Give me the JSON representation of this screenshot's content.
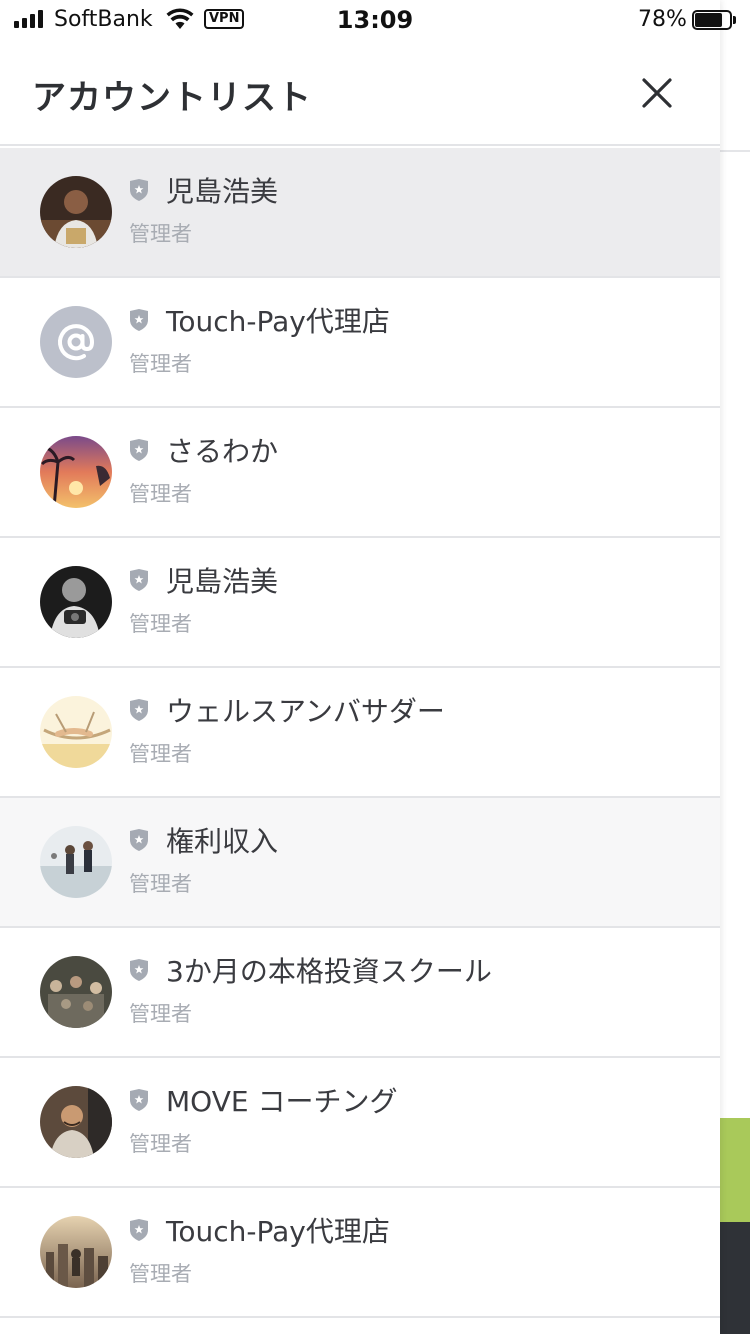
{
  "status_bar": {
    "carrier": "SoftBank",
    "vpn_label": "VPN",
    "time": "13:09",
    "battery_percent": "78%"
  },
  "panel": {
    "title": "アカウントリスト",
    "close_icon": "close-icon"
  },
  "accounts": [
    {
      "name": "児島浩美",
      "role": "管理者",
      "avatar": "photo-man-laptop",
      "selected": true
    },
    {
      "name": "Touch-Pay代理店",
      "role": "管理者",
      "avatar": "at-sign-default"
    },
    {
      "name": "さるわか",
      "role": "管理者",
      "avatar": "photo-sunset-beach"
    },
    {
      "name": "児島浩美",
      "role": "管理者",
      "avatar": "photo-man-camera-bw"
    },
    {
      "name": "ウェルスアンバサダー",
      "role": "管理者",
      "avatar": "photo-beach-hammock"
    },
    {
      "name": "権利収入",
      "role": "管理者",
      "avatar": "photo-runners-beach"
    },
    {
      "name": "3か月の本格投資スクール",
      "role": "管理者",
      "avatar": "photo-crowd-party"
    },
    {
      "name": "MOVE コーチング",
      "role": "管理者",
      "avatar": "photo-man-cheering"
    },
    {
      "name": "Touch-Pay代理店",
      "role": "管理者",
      "avatar": "photo-city-skyline"
    }
  ],
  "colors": {
    "selected_row": "#ececee",
    "divider": "#e3e4e7",
    "role_text": "#a8acb3",
    "shield": "#a5aab3",
    "accent_green": "#a9c95a"
  }
}
